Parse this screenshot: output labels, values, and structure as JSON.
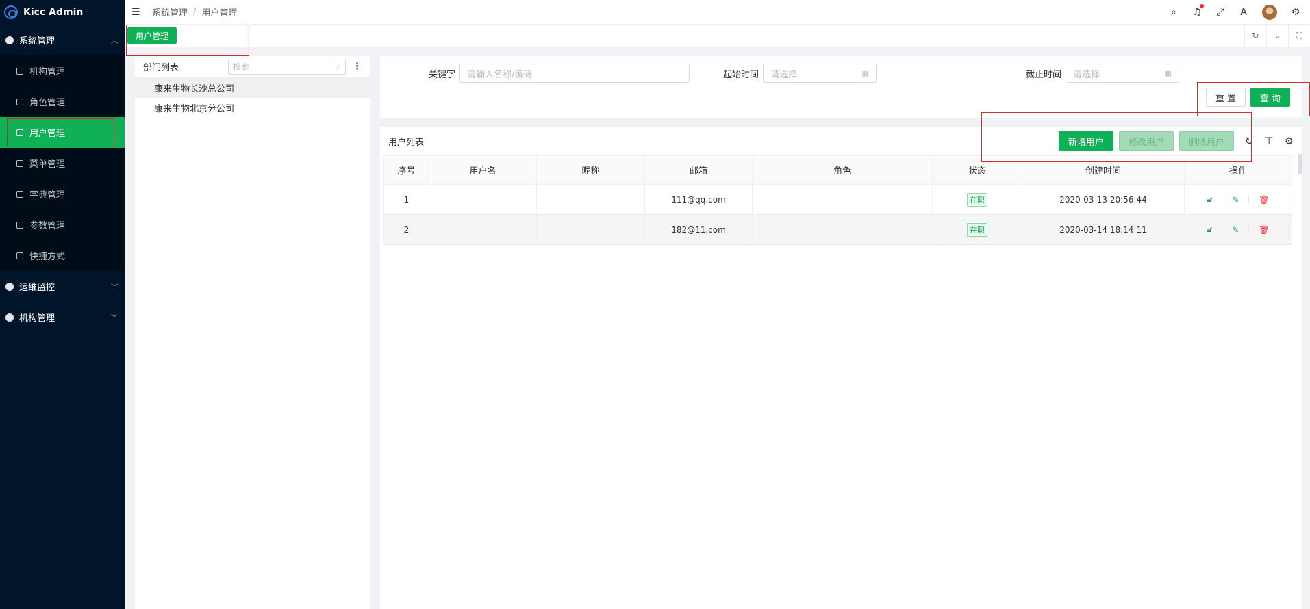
{
  "app": {
    "title": "Kicc Admin"
  },
  "sidebar": {
    "group_system": "系统管理",
    "items": [
      {
        "label": "机构管理",
        "icon": "org-icon"
      },
      {
        "label": "角色管理",
        "icon": "role-icon"
      },
      {
        "label": "用户管理",
        "icon": "user-icon",
        "active": true
      },
      {
        "label": "菜单管理",
        "icon": "menu-icon"
      },
      {
        "label": "字典管理",
        "icon": "dict-icon"
      },
      {
        "label": "参数管理",
        "icon": "param-icon"
      },
      {
        "label": "快捷方式",
        "icon": "shortcut-icon"
      }
    ],
    "group_ops": "运维监控",
    "group_org": "机构管理"
  },
  "header": {
    "breadcrumb": [
      "系统管理",
      "用户管理"
    ],
    "breadcrumb_sep": "/",
    "icons": [
      "search-icon",
      "bell-icon",
      "fullscreen-icon",
      "translate-icon",
      "avatar",
      "settings-icon"
    ]
  },
  "tabs": {
    "active_label": "用户管理"
  },
  "dept": {
    "title": "部门列表",
    "search_placeholder": "搜索",
    "tree": [
      "康来生物长沙总公司",
      "康来生物北京分公司"
    ]
  },
  "filter": {
    "keyword_label": "关键字",
    "keyword_placeholder": "请输入名称/编码",
    "start_label": "起始时间",
    "start_placeholder": "请选择",
    "end_label": "截止时间",
    "end_placeholder": "请选择",
    "reset_label": "重 置",
    "query_label": "查 询"
  },
  "table": {
    "title": "用户列表",
    "add_label": "新增用户",
    "edit_label": "修改用户",
    "delete_label": "删除用户",
    "columns": [
      "序号",
      "用户名",
      "昵称",
      "邮箱",
      "角色",
      "状态",
      "创建时间",
      "操作"
    ],
    "rows": [
      {
        "index": "1",
        "username": "",
        "nickname": "",
        "email": "111@qq.com",
        "role": "",
        "status": "在职",
        "created": "2020-03-13 20:56:44"
      },
      {
        "index": "2",
        "username": "",
        "nickname": "",
        "email": "182@11.com",
        "role": "",
        "status": "在职",
        "created": "2020-03-14 18:14:11"
      }
    ]
  },
  "colors": {
    "primary": "#10b057",
    "sidebar_bg": "#001529",
    "danger": "#f5222d"
  }
}
